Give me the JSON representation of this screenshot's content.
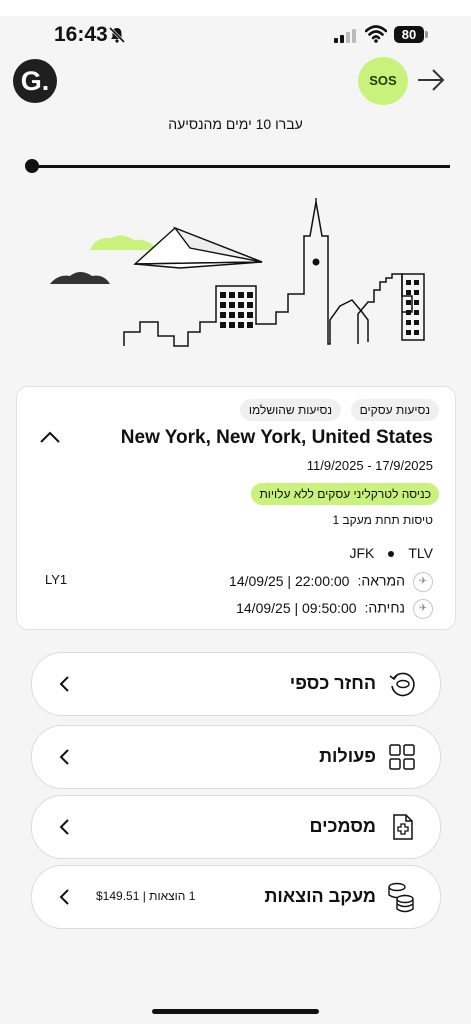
{
  "status_bar": {
    "time": "16:43",
    "battery": "80"
  },
  "header": {
    "logo_letter": "G.",
    "sos_label": "SOS"
  },
  "trip_progress": {
    "days_text": "עברו 10 ימים מהנסיעה"
  },
  "trip_card": {
    "tag_business": "נסיעות עסקים",
    "tag_completed": "נסיעות שהושלמו",
    "destination": "New York, New York, United States",
    "date_range": "11/9/2025 - 17/9/2025",
    "badge": "כניסה לטרקליני עסקים ללא עלויות",
    "flights_tracked": "טיסות תחת מעקב 1",
    "origin": "TLV",
    "destination_code": "JFK",
    "flight_number": "LY1",
    "departure_label": "המראה:",
    "departure_value": "14/09/25 | 22:00:00",
    "arrival_label": "נחיתה:",
    "arrival_value": "14/09/25 | 09:50:00"
  },
  "actions": [
    {
      "label": "החזר כספי",
      "icon": "refund-icon"
    },
    {
      "label": "פעולות",
      "icon": "grid-icon"
    },
    {
      "label": "מסמכים",
      "icon": "medical-document-icon"
    },
    {
      "label": "מעקב הוצאות",
      "icon": "coins-icon",
      "meta": "1 הוצאות | $149.51"
    }
  ],
  "colors": {
    "accent_green": "#c9f27c",
    "background": "#f5f5f5",
    "text": "#111111"
  }
}
